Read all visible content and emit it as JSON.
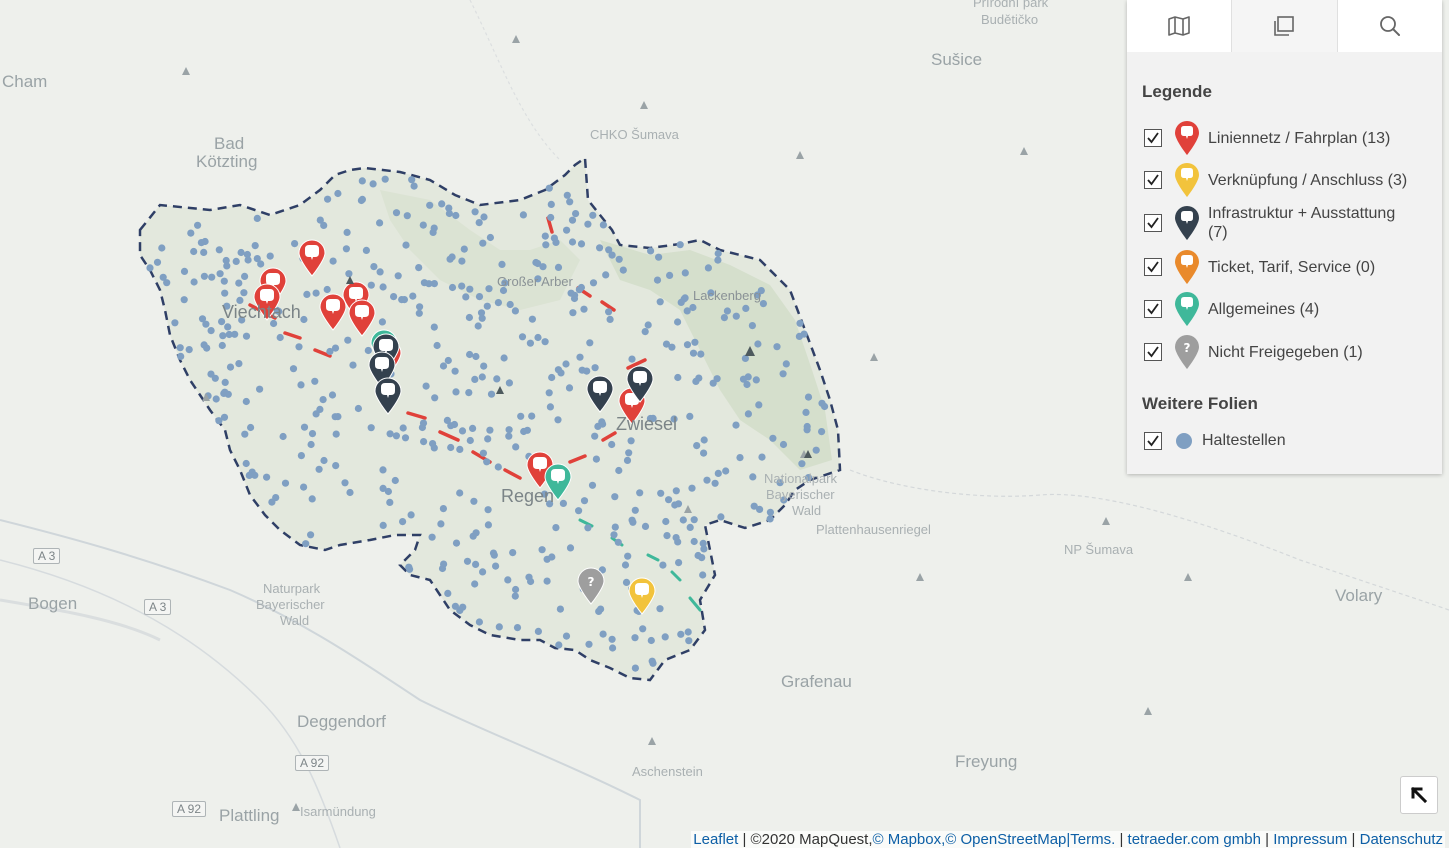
{
  "map": {
    "places": [
      {
        "id": "cham",
        "label": "Cham"
      },
      {
        "id": "bad",
        "label": "Bad"
      },
      {
        "id": "koetzting",
        "label": "Kötzting"
      },
      {
        "id": "susice",
        "label": "Sušice"
      },
      {
        "id": "chko",
        "label": "CHKO Šumava"
      },
      {
        "id": "budeticko",
        "label": "Budětičko"
      },
      {
        "id": "prirodni",
        "label": "Přírodní park"
      },
      {
        "id": "grosser_arber",
        "label": "Großer Arber"
      },
      {
        "id": "lackenberg",
        "label": "Lackenberg"
      },
      {
        "id": "viechtach",
        "label": "Viechtach"
      },
      {
        "id": "zwiesel",
        "label": "Zwiesel"
      },
      {
        "id": "regen",
        "label": "Regen"
      },
      {
        "id": "np_line1",
        "label": "Nationalpark"
      },
      {
        "id": "np_line2",
        "label": "Bayerischer"
      },
      {
        "id": "np_line3",
        "label": "Wald"
      },
      {
        "id": "plattenhausen",
        "label": "Plattenhausenriegel"
      },
      {
        "id": "np_sumava",
        "label": "NP Šumava"
      },
      {
        "id": "bogen",
        "label": "Bogen"
      },
      {
        "id": "naturpark1",
        "label": "Naturpark"
      },
      {
        "id": "naturpark2",
        "label": "Bayerischer"
      },
      {
        "id": "naturpark3",
        "label": "Wald"
      },
      {
        "id": "volary",
        "label": "Volary"
      },
      {
        "id": "grafenau",
        "label": "Grafenau"
      },
      {
        "id": "deggendorf",
        "label": "Deggendorf"
      },
      {
        "id": "freyung",
        "label": "Freyung"
      },
      {
        "id": "aschenstein",
        "label": "Aschenstein"
      },
      {
        "id": "plattling",
        "label": "Plattling"
      },
      {
        "id": "isarmuendung",
        "label": "Isarmündung"
      }
    ],
    "roads": [
      "A 3",
      "A 3",
      "A 92",
      "A 92"
    ]
  },
  "panel": {
    "tabs": [
      {
        "name": "map-icon"
      },
      {
        "name": "layers-icon"
      },
      {
        "name": "search-icon"
      }
    ],
    "legend_title": "Legende",
    "legend": [
      {
        "label": "Liniennetz / Fahrplan (13)",
        "color": "#e0413a",
        "checked": true
      },
      {
        "label": "Verknüpfung / Anschluss (3)",
        "color": "#f2c33c",
        "checked": true
      },
      {
        "label": "Infrastruktur + Ausstattung (7)",
        "color": "#34414e",
        "checked": true
      },
      {
        "label": "Ticket, Tarif, Service (0)",
        "color": "#e98a2c",
        "checked": true
      },
      {
        "label": "Allgemeines (4)",
        "color": "#3fb89a",
        "checked": true
      },
      {
        "label": "Nicht Freigegeben (1)",
        "color": "#9e9e9e",
        "checked": true
      }
    ],
    "more_title": "Weitere Folien",
    "more": [
      {
        "label": "Haltestellen",
        "color": "#7f9fc2",
        "checked": true
      }
    ]
  },
  "attribution": {
    "leaflet": "Leaflet",
    "sep1": " | ©2020 MapQuest,",
    "mapbox": "© Mapbox,",
    "osm": "© OpenStreetMap",
    "terms": "|Terms.",
    "sep2": " | ",
    "tetraeder": "tetraeder.com gmbh",
    "sep3": " | ",
    "impressum": "Impressum",
    "sep4": " | ",
    "datenschutz": "Datenschutz"
  }
}
